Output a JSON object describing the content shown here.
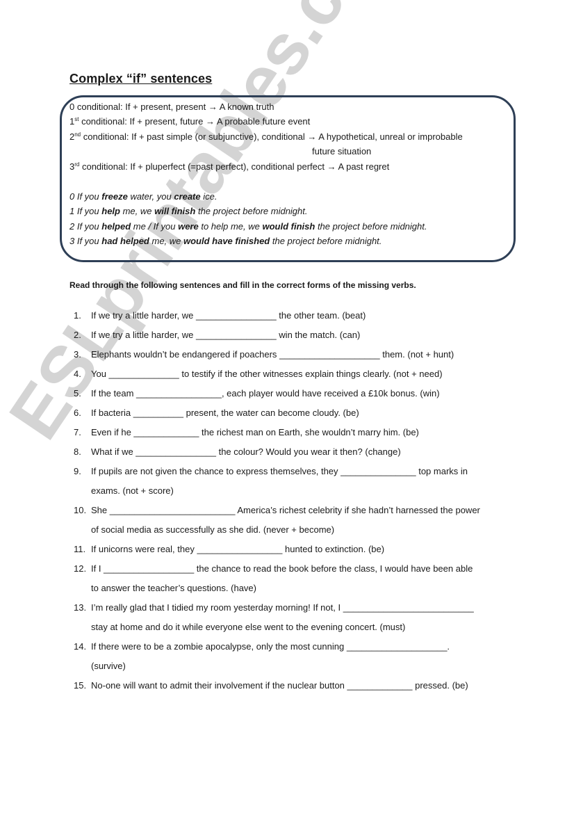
{
  "title": "Complex “if” sentences",
  "rules": [
    {
      "num": "0",
      "sup": "",
      "text": " conditional: If + present, present ",
      "arrow": "→",
      "result": " A known truth",
      "cont": ""
    },
    {
      "num": "1",
      "sup": "st",
      "text": " conditional: If + present, future ",
      "arrow": "→",
      "result": " A probable future event",
      "cont": ""
    },
    {
      "num": "2",
      "sup": "nd",
      "text": " conditional: If + past simple (or subjunctive), conditional ",
      "arrow": "→",
      "result": " A hypothetical, unreal or improbable",
      "cont": "future situation"
    },
    {
      "num": "3",
      "sup": "rd",
      "text": " conditional: If + pluperfect (=past perfect), conditional perfect ",
      "arrow": "→",
      "result": " A past regret",
      "cont": ""
    }
  ],
  "examples": [
    {
      "parts": [
        "0 If you ",
        "freeze",
        " water, you ",
        "create",
        " ice."
      ]
    },
    {
      "parts": [
        "1 If you ",
        "help",
        " me, we ",
        "will finish",
        " the project before midnight."
      ]
    },
    {
      "parts": [
        "2 If you ",
        "helped",
        " me / If you ",
        "were",
        " to help me, we ",
        "would finish",
        " the project before midnight."
      ]
    },
    {
      "parts": [
        "3 If you ",
        "had helped",
        " me, we ",
        "would have finished",
        " the project before midnight."
      ]
    }
  ],
  "instruction": "Read through the following sentences and fill in the correct forms of the missing verbs.",
  "questions": [
    {
      "num": "1.",
      "lines": [
        "If we try a little harder, we ________________ the other team. (beat)"
      ]
    },
    {
      "num": "2.",
      "lines": [
        "If we try a little harder, we ________________ win the match. (can)"
      ]
    },
    {
      "num": "3.",
      "lines": [
        "Elephants wouldn’t be endangered if poachers ____________________ them. (not + hunt)"
      ]
    },
    {
      "num": "4.",
      "lines": [
        "You ______________ to testify if the other witnesses explain things clearly. (not + need)"
      ]
    },
    {
      "num": "5.",
      "lines": [
        "If the team _________________, each player would have received a £10k bonus. (win)"
      ]
    },
    {
      "num": "6.",
      "lines": [
        "If bacteria __________ present, the water can become cloudy. (be)"
      ]
    },
    {
      "num": "7.",
      "lines": [
        "Even if he _____________ the richest man on Earth, she wouldn’t marry him. (be)"
      ]
    },
    {
      "num": "8.",
      "lines": [
        "What if we ________________ the colour? Would you wear it then? (change)"
      ]
    },
    {
      "num": "9.",
      "lines": [
        "If pupils are not given the chance to express themselves, they _______________ top marks in",
        "exams. (not + score)"
      ]
    },
    {
      "num": "10.",
      "lines": [
        "She _________________________ America’s richest celebrity if she hadn’t harnessed the power",
        "of social media as successfully as she did. (never + become)"
      ]
    },
    {
      "num": "11.",
      "lines": [
        "If unicorns were real, they _________________ hunted to extinction. (be)"
      ]
    },
    {
      "num": "12.",
      "lines": [
        "If I __________________ the chance to read the book before the class, I would have been able",
        "to answer the teacher’s questions. (have)"
      ]
    },
    {
      "num": "13.",
      "lines": [
        "I’m really glad that I tidied my room yesterday morning! If not, I __________________________",
        "stay at home and do it while everyone else went to the evening concert. (must)"
      ]
    },
    {
      "num": "14.",
      "lines": [
        "If there were to be a zombie apocalypse, only the most cunning ____________________.",
        "(survive)"
      ]
    },
    {
      "num": "15.",
      "lines": [
        "No-one will want to admit their involvement if the nuclear button _____________ pressed. (be)"
      ]
    }
  ],
  "watermark": "ESLprintables.com",
  "colors": {
    "box_border": "#2e3f56"
  }
}
